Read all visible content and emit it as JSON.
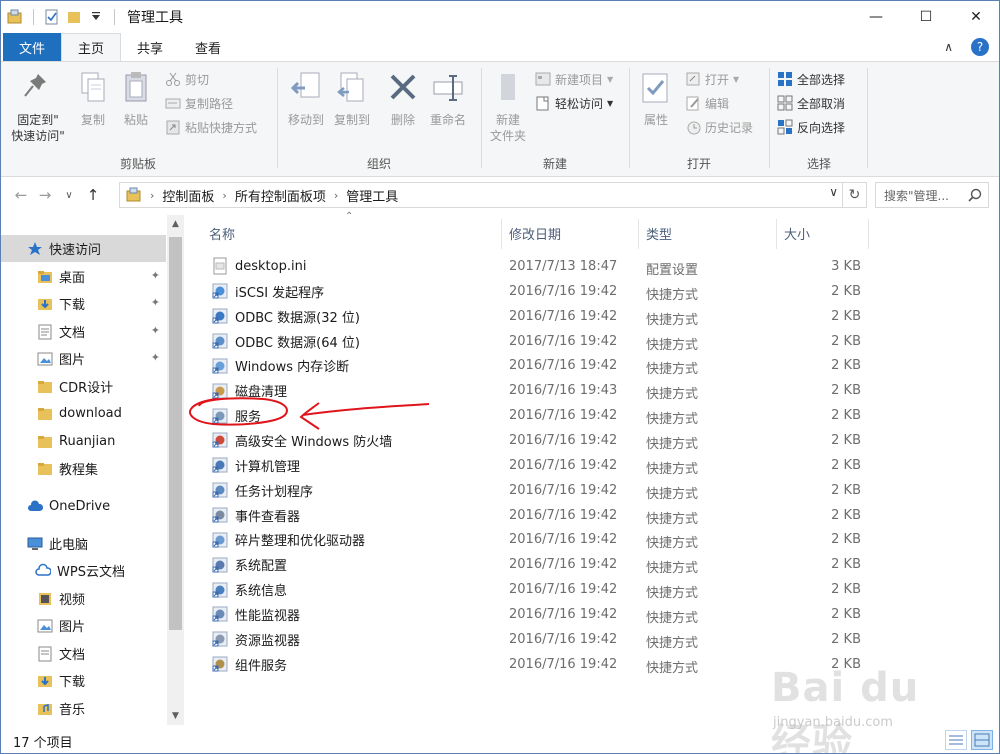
{
  "window": {
    "title": "管理工具",
    "controls": {
      "minimize": "—",
      "maximize": "☐",
      "close": "✕"
    }
  },
  "tabs": {
    "file": "文件",
    "home": "主页",
    "share": "共享",
    "view": "查看",
    "collapse": "∧",
    "help": "?"
  },
  "ribbon": {
    "clipboard": {
      "label": "剪贴板",
      "pin": "固定到\"\n快速访问\"",
      "copy": "复制",
      "paste": "粘贴",
      "cut": "剪切",
      "copy_path": "复制路径",
      "paste_shortcut": "粘贴快捷方式"
    },
    "organize": {
      "label": "组织",
      "move_to": "移动到",
      "copy_to": "复制到",
      "delete": "删除",
      "rename": "重命名"
    },
    "new": {
      "label": "新建",
      "new_folder": "新建\n文件夹",
      "new_item": "新建项目",
      "easy_access": "轻松访问"
    },
    "open": {
      "label": "打开",
      "properties": "属性",
      "open": "打开",
      "edit": "编辑",
      "history": "历史记录"
    },
    "select": {
      "label": "选择",
      "select_all": "全部选择",
      "select_none": "全部取消",
      "invert": "反向选择"
    }
  },
  "address": {
    "back": "←",
    "forward": "→",
    "recent": "∨",
    "up": "↑",
    "crumbs": [
      "控制面板",
      "所有控制面板项",
      "管理工具"
    ],
    "refresh": "↻",
    "search_placeholder": "搜索\"管理..."
  },
  "nav": {
    "items": [
      {
        "label": "快速访问",
        "icon": "star-icon"
      },
      {
        "label": "桌面",
        "icon": "folder-icon"
      },
      {
        "label": "下载",
        "icon": "download-icon"
      },
      {
        "label": "文档",
        "icon": "document-icon"
      },
      {
        "label": "图片",
        "icon": "picture-icon"
      },
      {
        "label": "CDR设计",
        "icon": "folder-icon"
      },
      {
        "label": "download",
        "icon": "folder-icon"
      },
      {
        "label": "Ruanjian",
        "icon": "folder-icon"
      },
      {
        "label": "教程集",
        "icon": "folder-icon"
      },
      {
        "label": "OneDrive",
        "icon": "cloud-icon"
      },
      {
        "label": "此电脑",
        "icon": "pc-icon"
      },
      {
        "label": "WPS云文档",
        "icon": "cloud-icon"
      },
      {
        "label": "视频",
        "icon": "video-icon"
      },
      {
        "label": "图片",
        "icon": "picture-icon"
      },
      {
        "label": "文档",
        "icon": "document-icon"
      },
      {
        "label": "下载",
        "icon": "download-icon"
      },
      {
        "label": "音乐",
        "icon": "music-icon"
      }
    ]
  },
  "columns": {
    "name": "名称",
    "date": "修改日期",
    "type": "类型",
    "size": "大小"
  },
  "files": [
    {
      "name": "desktop.ini",
      "date": "2017/7/13 18:47",
      "type": "配置设置",
      "size": "3 KB"
    },
    {
      "name": "iSCSI 发起程序",
      "date": "2016/7/16 19:42",
      "type": "快捷方式",
      "size": "2 KB"
    },
    {
      "name": "ODBC 数据源(32 位)",
      "date": "2016/7/16 19:42",
      "type": "快捷方式",
      "size": "2 KB"
    },
    {
      "name": "ODBC 数据源(64 位)",
      "date": "2016/7/16 19:42",
      "type": "快捷方式",
      "size": "2 KB"
    },
    {
      "name": "Windows 内存诊断",
      "date": "2016/7/16 19:42",
      "type": "快捷方式",
      "size": "2 KB"
    },
    {
      "name": "磁盘清理",
      "date": "2016/7/16 19:43",
      "type": "快捷方式",
      "size": "2 KB"
    },
    {
      "name": "服务",
      "date": "2016/7/16 19:42",
      "type": "快捷方式",
      "size": "2 KB"
    },
    {
      "name": "高级安全 Windows 防火墙",
      "date": "2016/7/16 19:42",
      "type": "快捷方式",
      "size": "2 KB"
    },
    {
      "name": "计算机管理",
      "date": "2016/7/16 19:42",
      "type": "快捷方式",
      "size": "2 KB"
    },
    {
      "name": "任务计划程序",
      "date": "2016/7/16 19:42",
      "type": "快捷方式",
      "size": "2 KB"
    },
    {
      "name": "事件查看器",
      "date": "2016/7/16 19:42",
      "type": "快捷方式",
      "size": "2 KB"
    },
    {
      "name": "碎片整理和优化驱动器",
      "date": "2016/7/16 19:42",
      "type": "快捷方式",
      "size": "2 KB"
    },
    {
      "name": "系统配置",
      "date": "2016/7/16 19:42",
      "type": "快捷方式",
      "size": "2 KB"
    },
    {
      "name": "系统信息",
      "date": "2016/7/16 19:42",
      "type": "快捷方式",
      "size": "2 KB"
    },
    {
      "name": "性能监视器",
      "date": "2016/7/16 19:42",
      "type": "快捷方式",
      "size": "2 KB"
    },
    {
      "name": "资源监视器",
      "date": "2016/7/16 19:42",
      "type": "快捷方式",
      "size": "2 KB"
    },
    {
      "name": "组件服务",
      "date": "2016/7/16 19:42",
      "type": "快捷方式",
      "size": "2 KB"
    }
  ],
  "status": {
    "count": "17 个项目"
  },
  "watermark": {
    "logo": "Bai du 经验",
    "url": "jingyan.baidu.com"
  },
  "colors": {
    "accent": "#1f6fbf",
    "annotation": "#e0151b",
    "selection": "#d9d9d9"
  }
}
